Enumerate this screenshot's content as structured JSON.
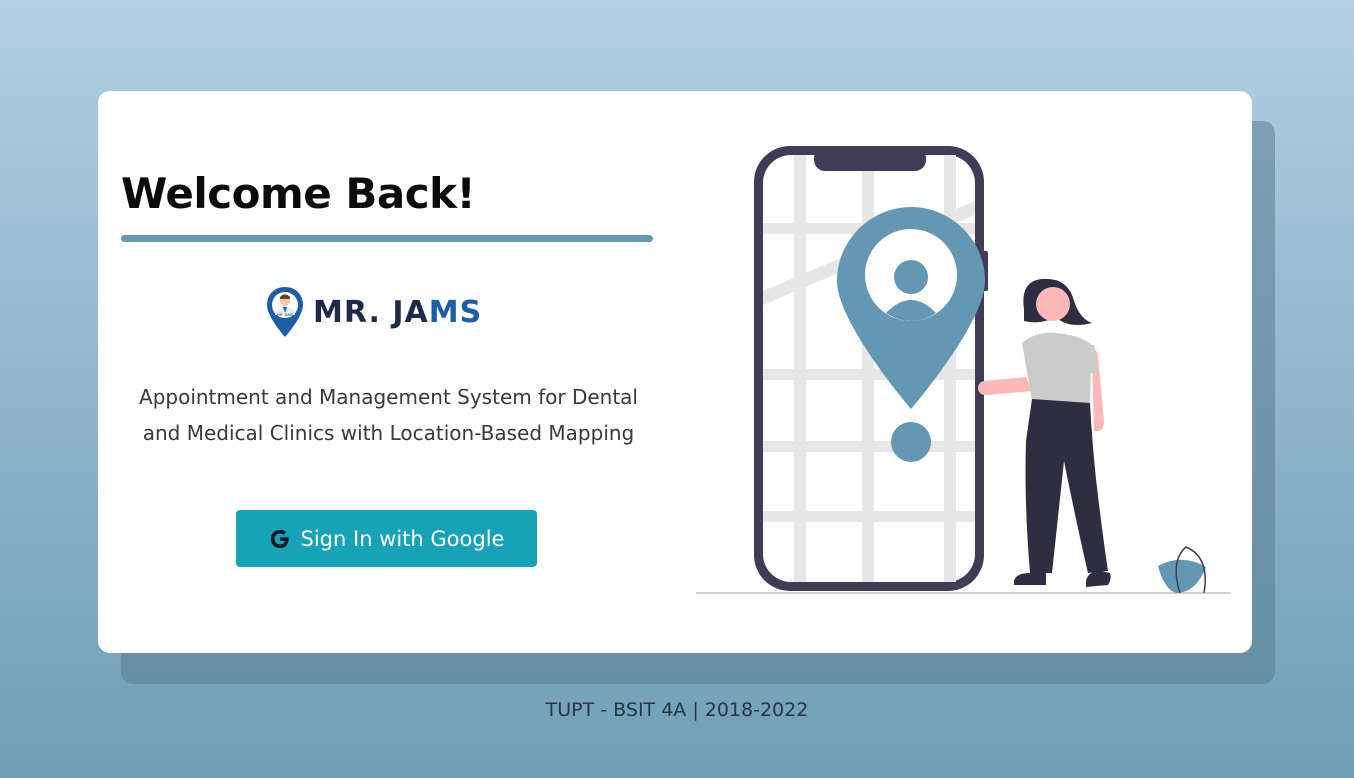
{
  "card": {
    "heading": "Welcome Back!",
    "logo": {
      "icon": "doctor-location-pin-icon",
      "text_primary": "MR. JA",
      "text_accent": "MS"
    },
    "tagline_line1": "Appointment and Management System for Dental",
    "tagline_line2": "and Medical Clinics with Location-Based Mapping",
    "signin_button": {
      "icon": "google-g-icon",
      "label": "Sign In with Google"
    },
    "illustration": "phone-map-location-woman-illustration"
  },
  "footer": {
    "text": "TUPT - BSIT 4A | 2018-2022"
  },
  "colors": {
    "accent": "#6497b1",
    "button": "#17a2b8",
    "navy": "#1c2b4a",
    "logo_blue": "#1c5fa8",
    "figure_dark": "#2f2e41",
    "skin": "#ffb8b8"
  }
}
